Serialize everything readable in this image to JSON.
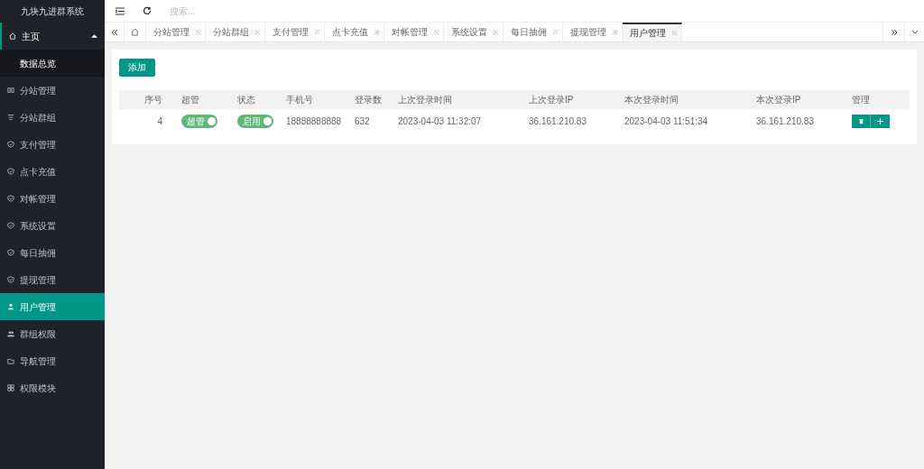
{
  "app_title": "九块九进群系统",
  "sidebar": {
    "items": [
      {
        "label": "主页",
        "kind": "home",
        "selected": false,
        "expanded": true,
        "children": [
          {
            "label": "数据总览",
            "selected": false
          }
        ]
      },
      {
        "label": "分站管理",
        "kind": "columns",
        "selected": false
      },
      {
        "label": "分站群组",
        "kind": "list",
        "selected": false
      },
      {
        "label": "支付管理",
        "kind": "shield",
        "selected": false
      },
      {
        "label": "点卡充值",
        "kind": "shield",
        "selected": false
      },
      {
        "label": "对帐管理",
        "kind": "shield",
        "selected": false
      },
      {
        "label": "系统设置",
        "kind": "shield",
        "selected": false
      },
      {
        "label": "每日抽佣",
        "kind": "shield",
        "selected": false
      },
      {
        "label": "提现管理",
        "kind": "shield",
        "selected": false
      },
      {
        "label": "用户管理",
        "kind": "user",
        "selected": true
      },
      {
        "label": "群组权限",
        "kind": "users",
        "selected": false
      },
      {
        "label": "导航管理",
        "kind": "folder",
        "selected": false
      },
      {
        "label": "权限模块",
        "kind": "grid",
        "selected": false
      }
    ]
  },
  "topbar": {
    "search": {
      "placeholder": "搜索..."
    }
  },
  "tabs": [
    {
      "label": "分站管理",
      "selected": false
    },
    {
      "label": "分站群组",
      "selected": false
    },
    {
      "label": "支付管理",
      "selected": false
    },
    {
      "label": "点卡充值",
      "selected": false
    },
    {
      "label": "对帐管理",
      "selected": false
    },
    {
      "label": "系统设置",
      "selected": false
    },
    {
      "label": "每日抽佣",
      "selected": false
    },
    {
      "label": "提现管理",
      "selected": false
    },
    {
      "label": "用户管理",
      "selected": true
    }
  ],
  "add_button": "添加",
  "table": {
    "columns": [
      "序号",
      "超管",
      "状态",
      "手机号",
      "登录数",
      "上次登录时间",
      "上次登录IP",
      "本次登录时间",
      "本次登录IP",
      "管理"
    ],
    "rows": [
      {
        "id": "4",
        "admin": {
          "label": "超管",
          "on": true
        },
        "status": {
          "label": "启用",
          "on": true
        },
        "phone": "18888888888",
        "logins": "632",
        "last_time": "2023-04-03 11:32:07",
        "last_ip": "36.161.210.83",
        "this_time": "2023-04-03 11:51:34",
        "this_ip": "36.161.210.83"
      }
    ]
  }
}
